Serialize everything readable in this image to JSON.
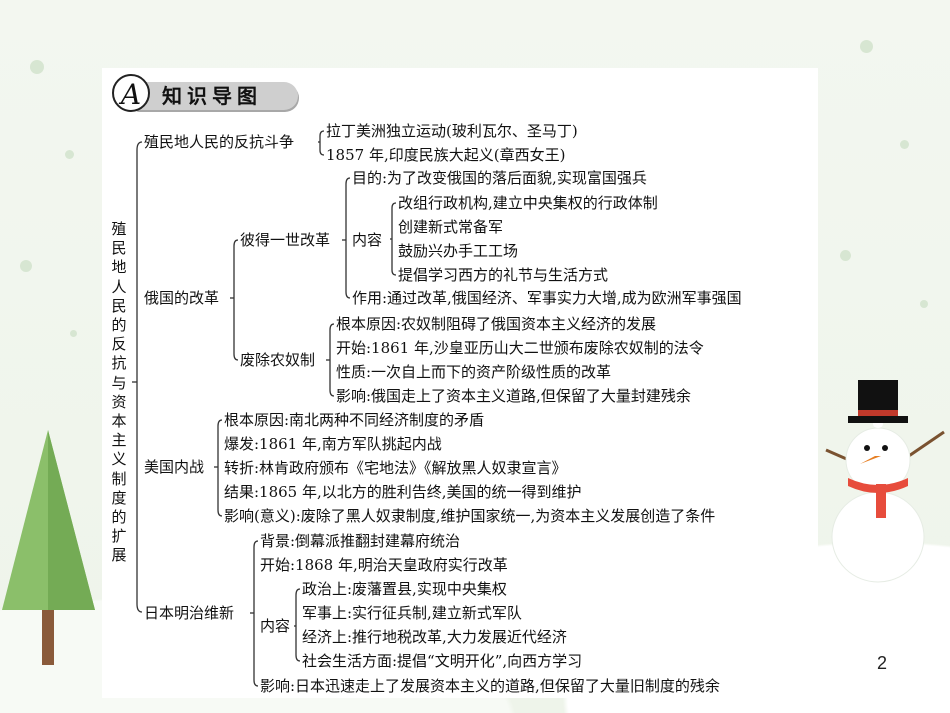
{
  "header": {
    "letter": "A",
    "title": "知识导图"
  },
  "title": "殖民地人民的反抗与资本主义制度的扩展",
  "colonial": {
    "label": "殖民地人民的反抗斗争",
    "items": [
      "拉丁美洲独立运动(玻利瓦尔、圣马丁)",
      "1857 年,印度民族大起义(章西女王)"
    ]
  },
  "russia": {
    "label": "俄国的改革",
    "peter": {
      "label": "彼得一世改革",
      "purpose": "目的:为了改变俄国的落后面貌,实现富国强兵",
      "content_label": "内容",
      "content": [
        "改组行政机构,建立中央集权的行政体制",
        "创建新式常备军",
        "鼓励兴办手工工场",
        "提倡学习西方的礼节与生活方式"
      ],
      "effect": "作用:通过改革,俄国经济、军事实力大增,成为欧洲军事强国"
    },
    "serf": {
      "label": "废除农奴制",
      "items": [
        "根本原因:农奴制阻碍了俄国资本主义经济的发展",
        "开始:1861 年,沙皇亚历山大二世颁布废除农奴制的法令",
        "性质:一次自上而下的资产阶级性质的改革",
        "影响:俄国走上了资本主义道路,但保留了大量封建残余"
      ]
    }
  },
  "us": {
    "label": "美国内战",
    "items": [
      "根本原因:南北两种不同经济制度的矛盾",
      "爆发:1861 年,南方军队挑起内战",
      "转折:林肯政府颁布《宅地法》《解放黑人奴隶宣言》",
      "结果:1865 年,以北方的胜利告终,美国的统一得到维护",
      "影响(意义):废除了黑人奴隶制度,维护国家统一,为资本主义发展创造了条件"
    ]
  },
  "japan": {
    "label": "日本明治维新",
    "background": "背景:倒幕派推翻封建幕府统治",
    "start": "开始:1868 年,明治天皇政府实行改革",
    "content_label": "内容",
    "content": [
      "政治上:废藩置县,实现中央集权",
      "军事上:实行征兵制,建立新式军队",
      "经济上:推行地税改革,大力发展近代经济",
      "社会生活方面:提倡“文明开化”,向西方学习"
    ],
    "effect": "影响:日本迅速走上了发展资本主义的道路,但保留了大量旧制度的残余"
  },
  "page_number": "2"
}
